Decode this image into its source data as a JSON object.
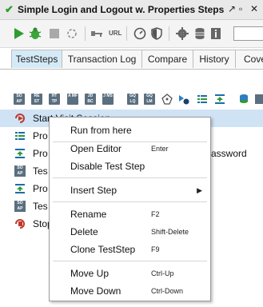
{
  "window": {
    "title": "Simple Login and Logout w. Properties Steps"
  },
  "toolbar": {
    "url_label": "URL"
  },
  "tabs": [
    {
      "label": "TestSteps",
      "active": true
    },
    {
      "label": "Transaction Log"
    },
    {
      "label": "Compare"
    },
    {
      "label": "History"
    },
    {
      "label": "Cove"
    }
  ],
  "steps_toolbar": {
    "icons": [
      {
        "name": "soap-request-icon",
        "text": "SO AP"
      },
      {
        "name": "rest-request-icon",
        "text": "RE ST"
      },
      {
        "name": "http-request-icon",
        "text": "HT TP"
      },
      {
        "name": "amf-request-icon",
        "text": "A MF"
      },
      {
        "name": "jdbc-request-icon",
        "text": "JD BC"
      },
      {
        "name": "jms-request-icon",
        "text": "J MS"
      },
      {
        "name": "graphql-query-icon",
        "text": "GQ LQ"
      },
      {
        "name": "graphql-mutation-icon",
        "text": "GQ LM"
      }
    ]
  },
  "steps": [
    {
      "label": "Start Visit Session",
      "icon": "start-step-icon",
      "selected": true
    },
    {
      "label": "Pro",
      "icon": "properties-step-icon"
    },
    {
      "label": "Pro",
      "icon": "property-transfer-icon",
      "suffix": "assword"
    },
    {
      "label": "Tes",
      "icon": "soap-step-icon"
    },
    {
      "label": "Pro",
      "icon": "property-transfer-icon"
    },
    {
      "label": "Tes",
      "icon": "soap-step-icon"
    },
    {
      "label": "Stop",
      "icon": "stop-step-icon"
    }
  ],
  "context_menu": {
    "run_from_here": "Run from here",
    "open_editor": "Open Editor",
    "open_editor_shortcut": "Enter",
    "disable_test_step": "Disable Test Step",
    "insert_step": "Insert Step",
    "rename": "Rename",
    "rename_shortcut": "F2",
    "delete": "Delete",
    "delete_shortcut": "Shift-Delete",
    "clone_teststep": "Clone TestStep",
    "clone_shortcut": "F9",
    "move_up": "Move Up",
    "move_up_shortcut": "Ctrl-Up",
    "move_down": "Move Down",
    "move_down_shortcut": "Ctrl-Down"
  }
}
